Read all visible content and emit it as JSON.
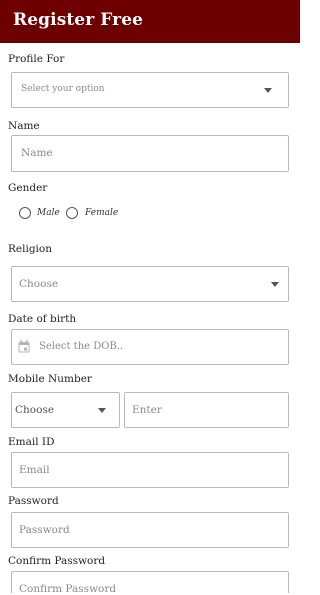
{
  "header": {
    "title": "Register Free"
  },
  "profile_for": {
    "label": "Profile For",
    "placeholder": "Select your option"
  },
  "name": {
    "label": "Name",
    "placeholder": "Name"
  },
  "gender": {
    "label": "Gender",
    "options": [
      "Male",
      "Female"
    ]
  },
  "religion": {
    "label": "Religion",
    "placeholder": "Choose"
  },
  "dob": {
    "label": "Date of birth",
    "placeholder": "Select the DOB.."
  },
  "mobile": {
    "label": "Mobile Number",
    "code_placeholder": "Choose",
    "number_placeholder": "Enter"
  },
  "email": {
    "label": "Email ID",
    "placeholder": "Email"
  },
  "password": {
    "label": "Password",
    "placeholder": "Password"
  },
  "confirm_password": {
    "label": "Confirm Password",
    "placeholder": "Confirm Password"
  },
  "colors": {
    "header_bg": "#6d0000",
    "border": "#b9b9b9",
    "placeholder": "#8a8a8a"
  },
  "icons": [
    "chevron-down-icon",
    "calendar-icon",
    "radio-icon"
  ]
}
